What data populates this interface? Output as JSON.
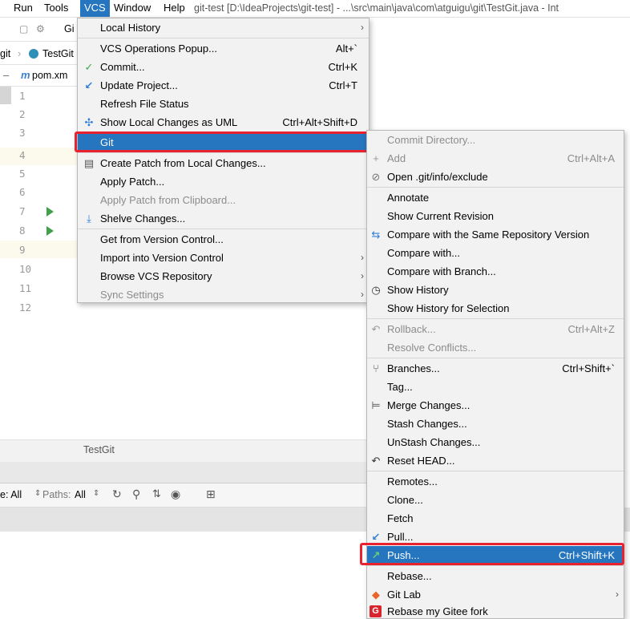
{
  "menubar": {
    "items": [
      "Run",
      "Tools",
      "VCS",
      "Window",
      "Help"
    ],
    "title": "git-test [D:\\IdeaProjects\\git-test] - ...\\src\\main\\java\\com\\atguigu\\git\\TestGit.java - Int"
  },
  "toolbar": {
    "frag": "Gi"
  },
  "breadcrumb": {
    "frag1": "git",
    "frag2": "TestGit"
  },
  "editor_tab": {
    "frag": "pom.xm"
  },
  "gutter": {
    "lines": [
      "1",
      "2",
      "3",
      "4",
      "5",
      "6",
      "7",
      "8",
      "9",
      "10",
      "11",
      "12"
    ]
  },
  "bottom": {
    "tab": "TestGit",
    "filter_prefix": "e: All",
    "paths_label": "Paths:",
    "paths_value": "All"
  },
  "vcs_menu": {
    "items": [
      {
        "label": "Local History"
      },
      {
        "label": "VCS Operations Popup...",
        "shortcut": "Alt+`"
      },
      {
        "label": "Commit...",
        "shortcut": "Ctrl+K"
      },
      {
        "label": "Update Project...",
        "shortcut": "Ctrl+T"
      },
      {
        "label": "Refresh File Status"
      },
      {
        "label": "Show Local Changes as UML",
        "shortcut": "Ctrl+Alt+Shift+D"
      },
      {
        "label": "Git"
      },
      {
        "label": "Create Patch from Local Changes..."
      },
      {
        "label": "Apply Patch..."
      },
      {
        "label": "Apply Patch from Clipboard..."
      },
      {
        "label": "Shelve Changes..."
      },
      {
        "label": "Get from Version Control..."
      },
      {
        "label": "Import into Version Control"
      },
      {
        "label": "Browse VCS Repository"
      },
      {
        "label": "Sync Settings"
      }
    ]
  },
  "git_menu": {
    "items": [
      {
        "label": "Commit Directory..."
      },
      {
        "label": "Add",
        "shortcut": "Ctrl+Alt+A"
      },
      {
        "label": "Open .git/info/exclude"
      },
      {
        "label": "Annotate"
      },
      {
        "label": "Show Current Revision"
      },
      {
        "label": "Compare with the Same Repository Version"
      },
      {
        "label": "Compare with..."
      },
      {
        "label": "Compare with Branch..."
      },
      {
        "label": "Show History"
      },
      {
        "label": "Show History for Selection"
      },
      {
        "label": "Rollback...",
        "shortcut": "Ctrl+Alt+Z"
      },
      {
        "label": "Resolve Conflicts..."
      },
      {
        "label": "Branches...",
        "shortcut": "Ctrl+Shift+`"
      },
      {
        "label": "Tag..."
      },
      {
        "label": "Merge Changes..."
      },
      {
        "label": "Stash Changes..."
      },
      {
        "label": "UnStash Changes..."
      },
      {
        "label": "Reset HEAD..."
      },
      {
        "label": "Remotes..."
      },
      {
        "label": "Clone..."
      },
      {
        "label": "Fetch"
      },
      {
        "label": "Pull..."
      },
      {
        "label": "Push...",
        "shortcut": "Ctrl+Shift+K"
      },
      {
        "label": "Rebase..."
      },
      {
        "label": "Git Lab"
      },
      {
        "label": "Rebase my Gitee fork"
      }
    ]
  },
  "colors": {
    "selection": "#2675bf",
    "highlight_box": "#e8222e",
    "disabled_text": "#8c8c8c",
    "menu_bg": "#f2f2f2"
  },
  "icons": {
    "commit": "checkmark-icon",
    "update": "blue-arrow-icon",
    "uml": "diagram-icon",
    "patch": "patch-icon",
    "shelve": "shelve-icon",
    "add": "plus-icon",
    "exclude": "gitignore-icon",
    "compare": "compare-arrows-icon",
    "history": "clock-icon",
    "rollback": "undo-icon",
    "branches": "branch-icon",
    "merge": "merge-icon",
    "reset": "reset-icon",
    "pull": "pull-arrow-icon",
    "push": "push-arrow-icon",
    "gitlab": "gitlab-fox-icon",
    "gitee": "gitee-logo-icon"
  }
}
